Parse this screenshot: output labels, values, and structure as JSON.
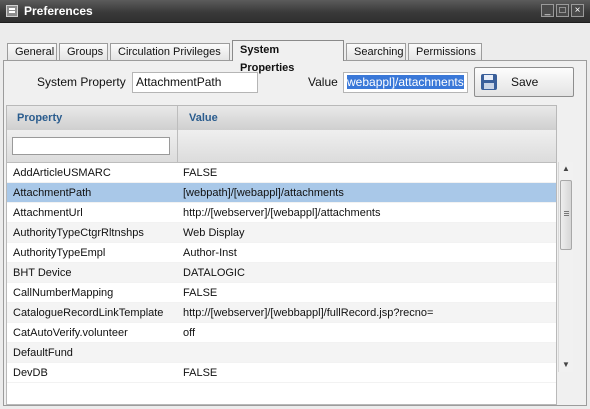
{
  "window": {
    "title": "Preferences",
    "title_icon": "window-icon",
    "controls": {
      "minimize": "_",
      "restore": "□",
      "close": "×"
    }
  },
  "tabs": [
    {
      "label": "General"
    },
    {
      "label": "Groups"
    },
    {
      "label": "Circulation Privileges"
    },
    {
      "label": "System Properties"
    },
    {
      "label": "Searching"
    },
    {
      "label": "Permissions"
    }
  ],
  "active_tab": "System Properties",
  "form": {
    "property_label": "System Property",
    "property_value": "AttachmentPath",
    "value_label": "Value",
    "value_text": "webappl]/attachments",
    "save_label": "Save",
    "save_icon": "save-disk-icon"
  },
  "grid": {
    "headers": {
      "property": "Property",
      "value": "Value"
    },
    "filter_value": "",
    "rows": [
      {
        "property": "AddArticleUSMARC",
        "value": "FALSE"
      },
      {
        "property": "AttachmentPath",
        "value": "[webpath]/[webappl]/attachments"
      },
      {
        "property": "AttachmentUrl",
        "value": "http://[webserver]/[webappl]/attachments"
      },
      {
        "property": "AuthorityTypeCtgrRltnshps",
        "value": "Web Display"
      },
      {
        "property": "AuthorityTypeEmpl",
        "value": "Author-Inst"
      },
      {
        "property": "BHT Device",
        "value": "DATALOGIC"
      },
      {
        "property": "CallNumberMapping",
        "value": "FALSE"
      },
      {
        "property": "CatalogueRecordLinkTemplate",
        "value": "http://[webserver]/[webbappl]/fullRecord.jsp?recno="
      },
      {
        "property": "CatAutoVerify.volunteer",
        "value": "off"
      },
      {
        "property": "DefaultFund",
        "value": ""
      },
      {
        "property": "DevDB",
        "value": "FALSE"
      }
    ],
    "selected_row": "AttachmentPath"
  },
  "colors": {
    "title_bar": "#3a3a3a",
    "header_text": "#2a5c8e",
    "selected_row": "#a9c8e8",
    "text_selection": "#3a78d8"
  }
}
